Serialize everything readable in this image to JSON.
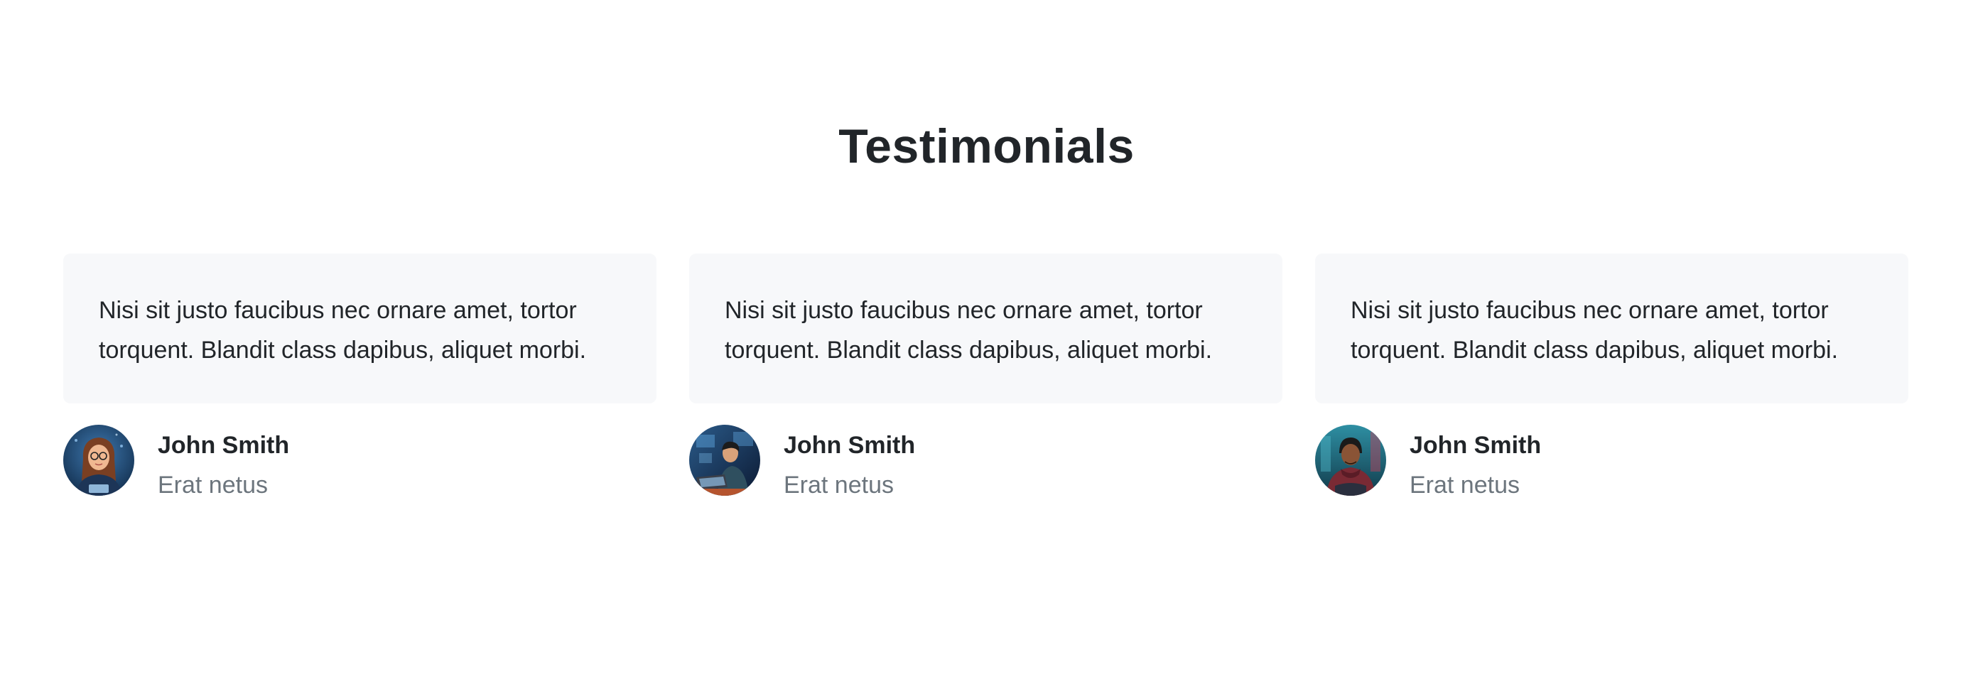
{
  "section": {
    "title": "Testimonials"
  },
  "testimonials": [
    {
      "quote": "Nisi sit justo faucibus nec ornare amet, tortor torquent. Blandit class dapibus, aliquet morbi.",
      "name": "John Smith",
      "role": "Erat netus",
      "avatar_icon": "woman-with-glasses-avatar"
    },
    {
      "quote": "Nisi sit justo faucibus nec ornare amet, tortor torquent. Blandit class dapibus, aliquet morbi.",
      "name": "John Smith",
      "role": "Erat netus",
      "avatar_icon": "man-at-laptop-avatar"
    },
    {
      "quote": "Nisi sit justo faucibus nec ornare amet, tortor torquent. Blandit class dapibus, aliquet morbi.",
      "name": "John Smith",
      "role": "Erat netus",
      "avatar_icon": "man-in-hoodie-avatar"
    }
  ],
  "colors": {
    "heading": "#212529",
    "muted": "#6c757d",
    "card_background": "#f7f8fa"
  }
}
